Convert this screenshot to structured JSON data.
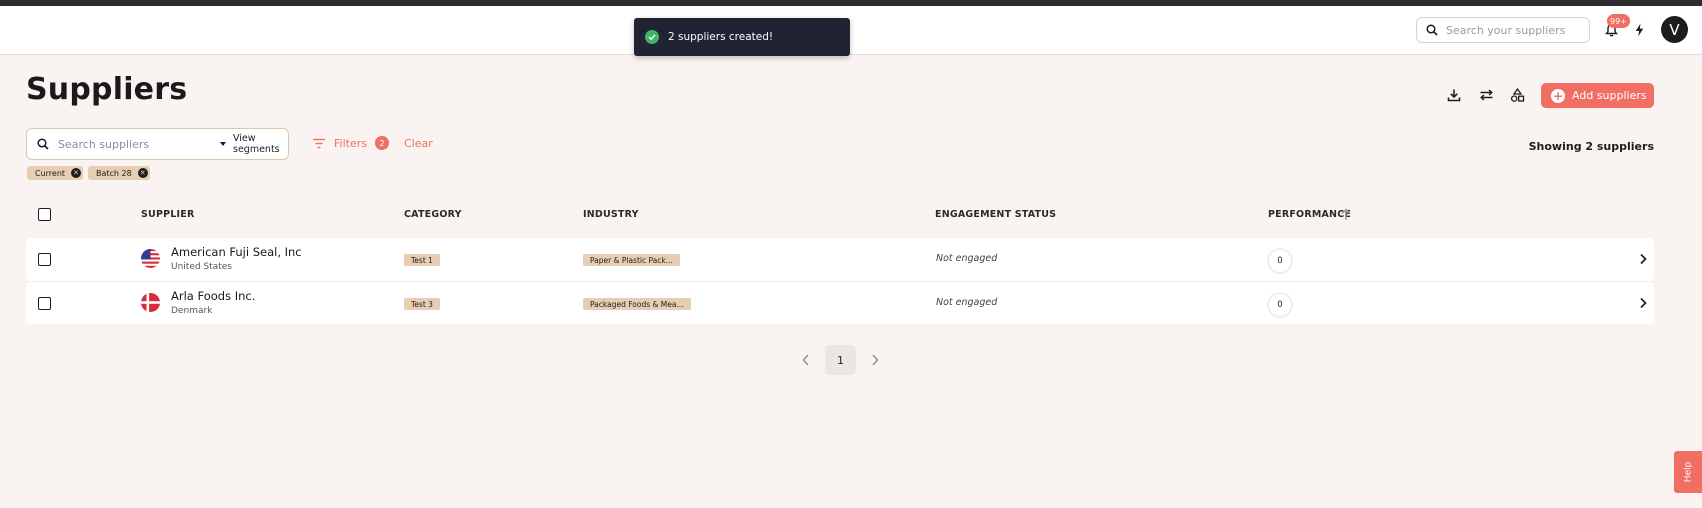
{
  "toast": {
    "message": "2 suppliers created!"
  },
  "header": {
    "search_placeholder": "Search your suppliers",
    "notification_badge": "99+",
    "avatar_initial": "V"
  },
  "page": {
    "title": "Suppliers",
    "add_button_label": "Add suppliers",
    "showing_text": "Showing 2 suppliers"
  },
  "toolbar": {
    "search_placeholder": "Search suppliers",
    "view_segments_label": "View segments",
    "filters_label": "Filters",
    "filters_count": "2",
    "clear_label": "Clear"
  },
  "chips": [
    {
      "label": "Current"
    },
    {
      "label": "Batch 28"
    }
  ],
  "table": {
    "columns": [
      "SUPPLIER",
      "CATEGORY",
      "INDUSTRY",
      "ENGAGEMENT STATUS",
      "PERFORMANCE"
    ],
    "rows": [
      {
        "name": "American Fuji Seal, Inc",
        "country": "United States",
        "category": "Test 1",
        "industry": "Paper & Plastic Pack...",
        "engagement": "Not engaged",
        "performance": "0",
        "flag": "us-flag-icon"
      },
      {
        "name": "Arla Foods Inc.",
        "country": "Denmark",
        "category": "Test 3",
        "industry": "Packaged Foods & Mea...",
        "engagement": "Not engaged",
        "performance": "0",
        "flag": "dk-flag-icon"
      }
    ]
  },
  "pagination": {
    "current_page": "1"
  },
  "help": {
    "label": "Help"
  },
  "colors": {
    "accent": "#f06e63",
    "tag": "#e7cdb1",
    "toast_bg": "#1f2332",
    "success": "#3fb46a"
  }
}
